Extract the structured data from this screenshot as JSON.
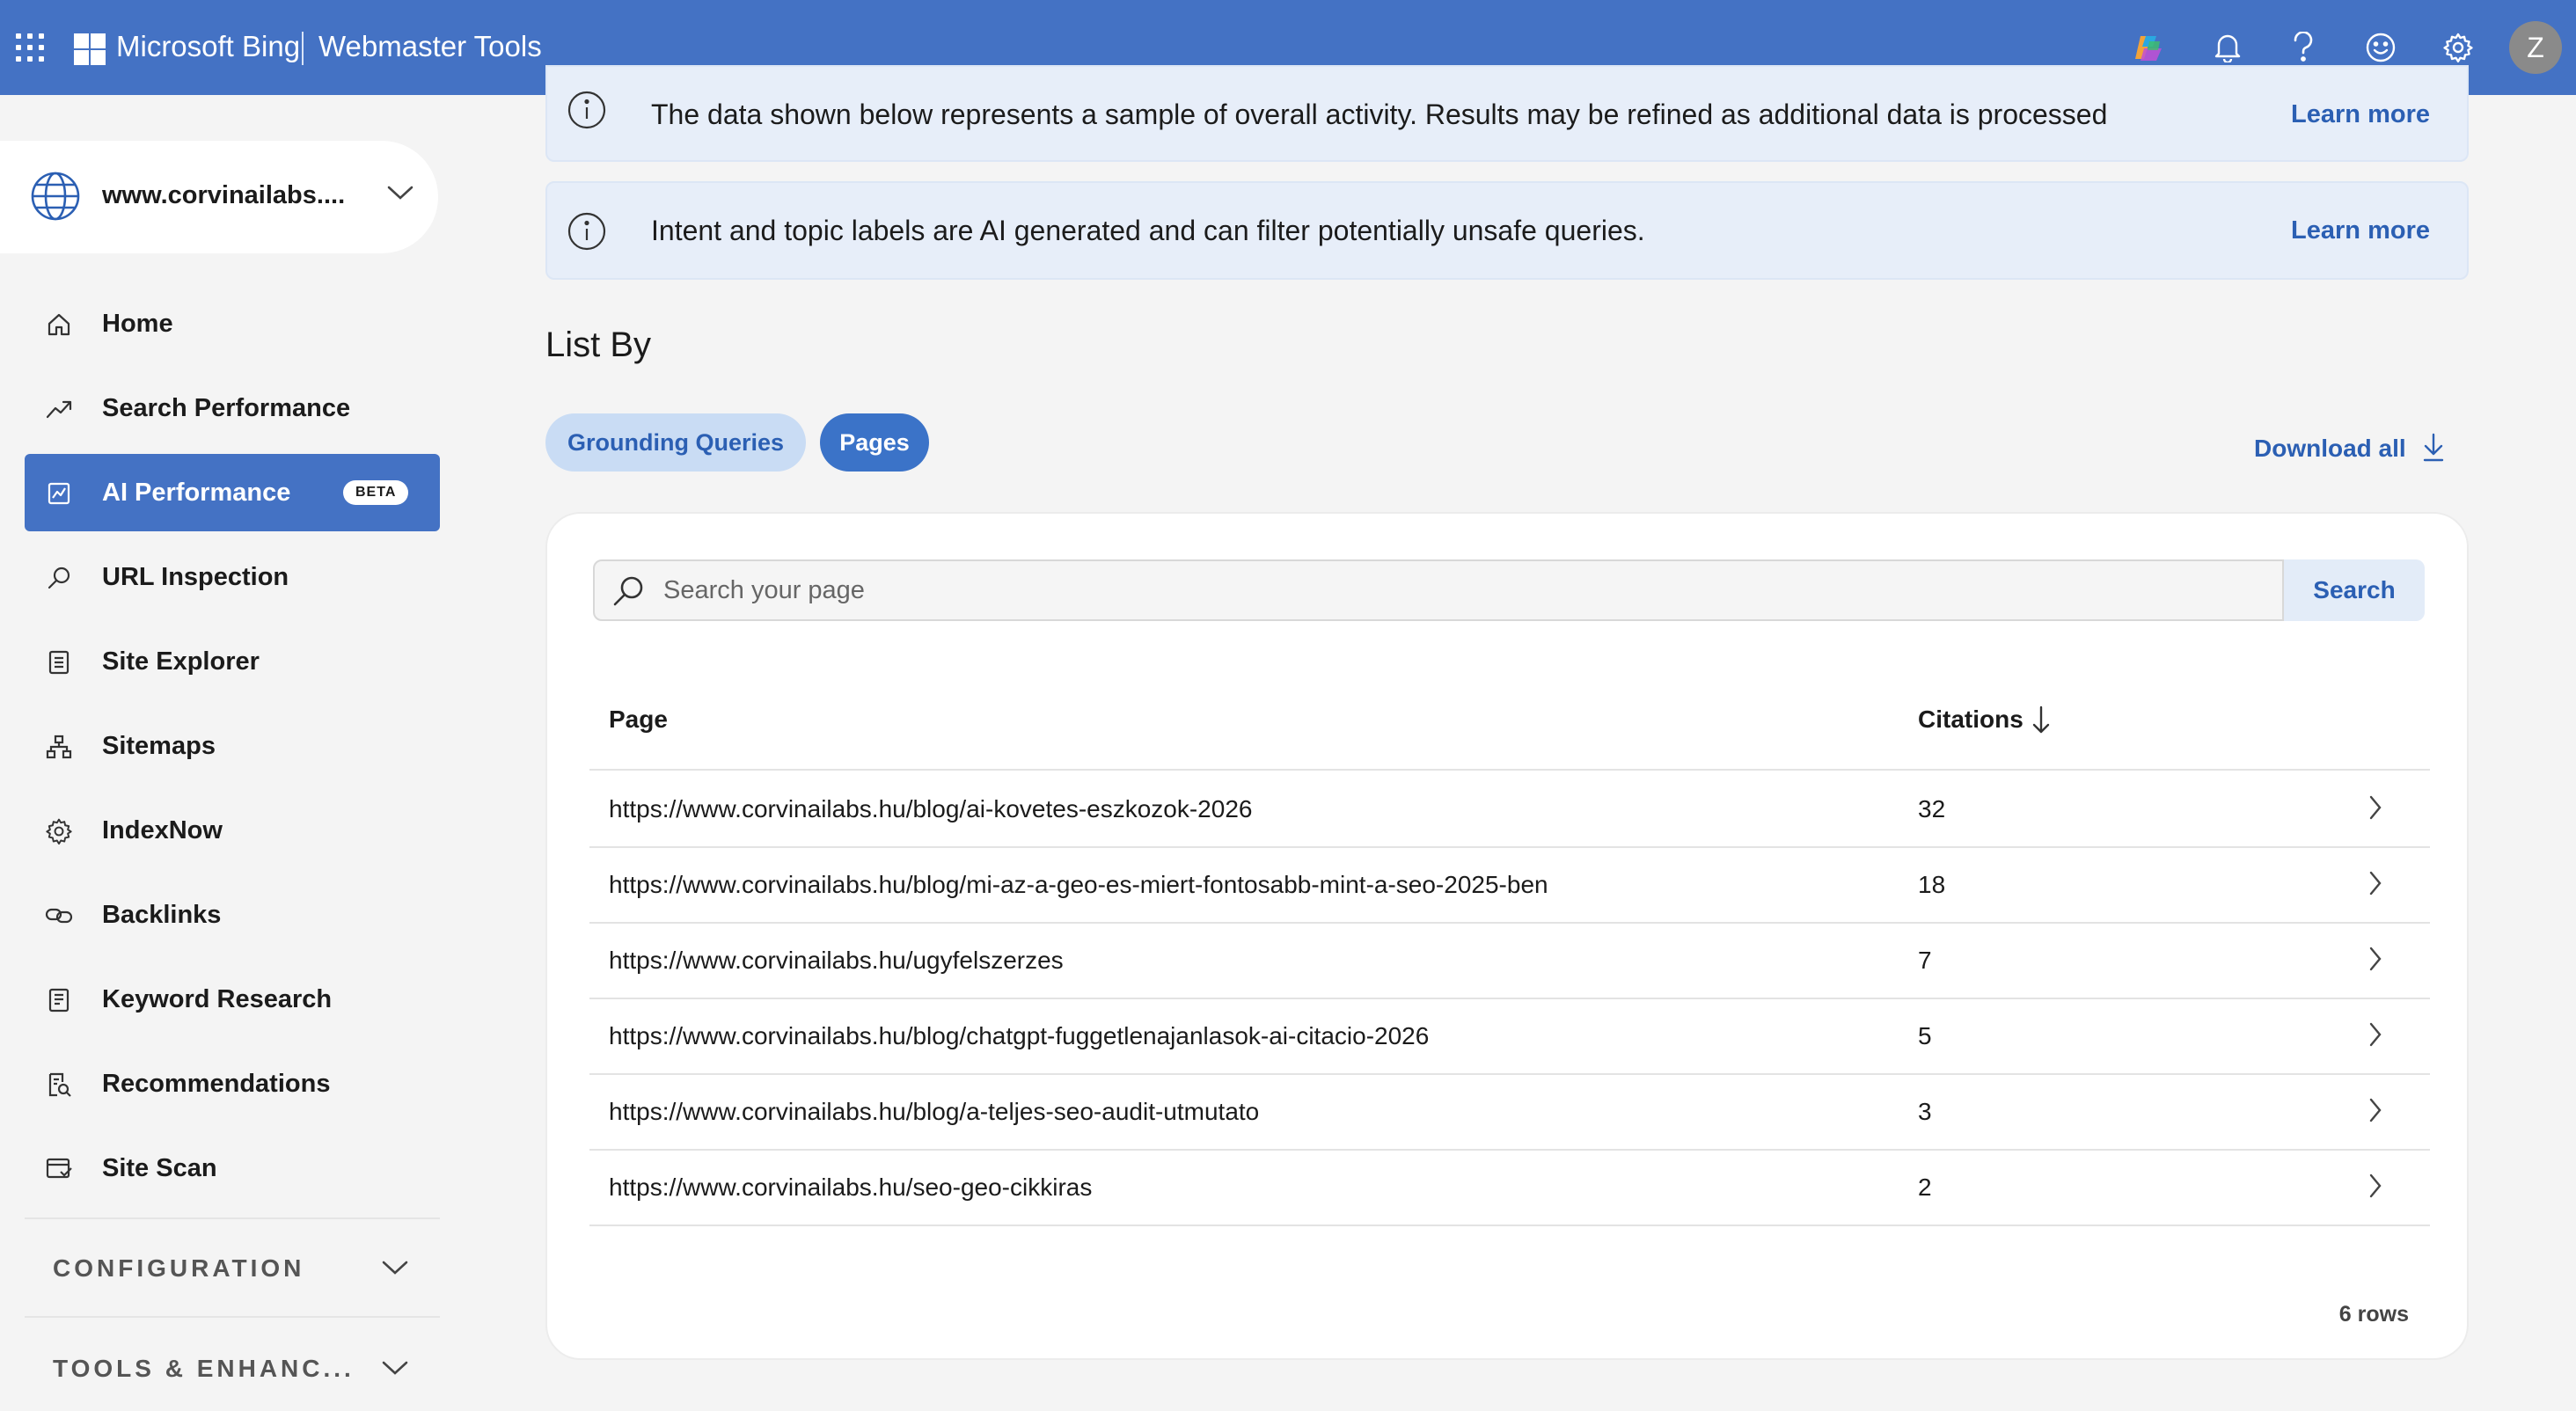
{
  "header": {
    "brand": "Microsoft Bing",
    "product": "Webmaster Tools",
    "avatar_initial": "Z",
    "icons": [
      "app-launcher-icon",
      "copilot-icon",
      "bell-icon",
      "help-icon",
      "feedback-smiley-icon",
      "gear-icon"
    ]
  },
  "sidebar": {
    "site": "www.corvinailabs....",
    "items": [
      {
        "label": "Home",
        "icon": "home-icon"
      },
      {
        "label": "Search Performance",
        "icon": "trend-icon"
      },
      {
        "label": "AI Performance",
        "icon": "chart-icon",
        "badge": "BETA",
        "active": true
      },
      {
        "label": "URL Inspection",
        "icon": "magnifier-icon"
      },
      {
        "label": "Site Explorer",
        "icon": "document-list-icon"
      },
      {
        "label": "Sitemaps",
        "icon": "sitemap-icon"
      },
      {
        "label": "IndexNow",
        "icon": "gear-icon"
      },
      {
        "label": "Backlinks",
        "icon": "link-icon"
      },
      {
        "label": "Keyword Research",
        "icon": "document-icon"
      },
      {
        "label": "Recommendations",
        "icon": "recommendation-icon"
      },
      {
        "label": "Site Scan",
        "icon": "scan-icon"
      }
    ],
    "sections": [
      {
        "label": "CONFIGURATION"
      },
      {
        "label": "TOOLS & ENHANC..."
      }
    ]
  },
  "banners": [
    {
      "text": "The data shown below represents a sample of overall activity. Results may be refined as additional data is processed",
      "link": "Learn more"
    },
    {
      "text": "Intent and topic labels are AI generated and can filter potentially unsafe queries.",
      "link": "Learn more"
    }
  ],
  "main": {
    "list_by": "List By",
    "tabs": [
      {
        "label": "Grounding Queries",
        "active": false
      },
      {
        "label": "Pages",
        "active": true
      }
    ],
    "download_all": "Download all",
    "search": {
      "placeholder": "Search your page",
      "button": "Search"
    },
    "table": {
      "columns": [
        "Page",
        "Citations"
      ],
      "sort": "Citations descending",
      "rows": [
        {
          "page": "https://www.corvinailabs.hu/blog/ai-kovetes-eszkozok-2026",
          "citations": "32"
        },
        {
          "page": "https://www.corvinailabs.hu/blog/mi-az-a-geo-es-miert-fontosabb-mint-a-seo-2025-ben",
          "citations": "18"
        },
        {
          "page": "https://www.corvinailabs.hu/ugyfelszerzes",
          "citations": "7"
        },
        {
          "page": "https://www.corvinailabs.hu/blog/chatgpt-fuggetlenajanlasok-ai-citacio-2026",
          "citations": "5"
        },
        {
          "page": "https://www.corvinailabs.hu/blog/a-teljes-seo-audit-utmutato",
          "citations": "3"
        },
        {
          "page": "https://www.corvinailabs.hu/seo-geo-cikkiras",
          "citations": "2"
        }
      ],
      "row_count": "6 rows"
    }
  },
  "colors": {
    "accent": "#4472c4",
    "link": "#2b5fb3",
    "banner_bg": "#e7eef9"
  }
}
